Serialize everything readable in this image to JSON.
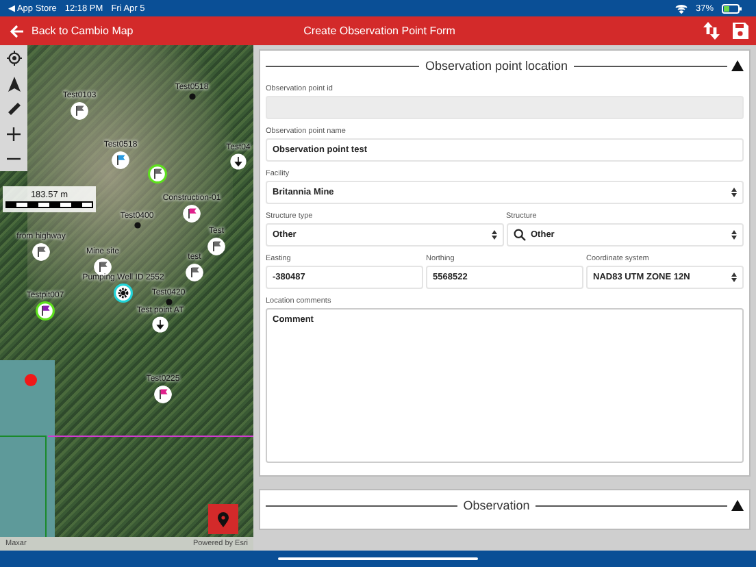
{
  "status_bar": {
    "back_app": "◀ App Store",
    "time": "12:18 PM",
    "date": "Fri Apr 5",
    "battery": "37%"
  },
  "header": {
    "back_label": "Back to Cambio Map",
    "title": "Create Observation Point Form"
  },
  "map": {
    "scale": "183.57 m",
    "attribution_left": "Maxar",
    "attribution_right": "Powered by Esri",
    "markers": [
      {
        "label": "Test0103",
        "kind": "flag",
        "color": "#6b6b6b",
        "ring": false
      },
      {
        "label": "Test0518",
        "kind": "dot"
      },
      {
        "label": "Test0518",
        "kind": "flag",
        "color": "#2a9be0",
        "ring": false
      },
      {
        "kind": "flag",
        "color": "#6b6b6b",
        "ring": true
      },
      {
        "label": "Test04",
        "kind": "drop"
      },
      {
        "label": "Construction-01",
        "kind": "flag",
        "color": "#e0208c",
        "ring": false
      },
      {
        "label": "Test0400",
        "kind": "dot"
      },
      {
        "label": "from highway",
        "kind": "flag",
        "color": "#6b6b6b",
        "ring": false
      },
      {
        "label": "Mine site",
        "kind": "flag",
        "color": "#6b6b6b",
        "ring": false
      },
      {
        "label": "Test",
        "kind": "flag",
        "color": "#6b6b6b",
        "ring": false
      },
      {
        "label": "test",
        "kind": "flag",
        "color": "#6b6b6b",
        "ring": false
      },
      {
        "label": "Pumping Well ID 2552",
        "kind": "gear"
      },
      {
        "label": "Testpit007",
        "kind": "flag",
        "color": "#8a1fb0",
        "ring": true
      },
      {
        "label": "Test0420",
        "kind": "dot"
      },
      {
        "label": "Test point AT",
        "kind": "drop"
      },
      {
        "label": "Test0225",
        "kind": "flag",
        "color": "#e0208c",
        "ring": false
      }
    ]
  },
  "sections": [
    {
      "title": "Observation point location",
      "expanded": true,
      "rows": [
        [
          {
            "label": "Observation point id",
            "kind": "text",
            "disabled": true
          }
        ],
        [
          {
            "label": "Observation point name",
            "kind": "text",
            "value": "Observation point test",
            "disabled": false
          }
        ],
        [
          {
            "label": "Facility",
            "kind": "select",
            "value": "Britannia Mine",
            "disabled": false
          }
        ],
        [
          {
            "label": "Structure type",
            "kind": "select",
            "value": "Other",
            "disabled": false
          },
          {
            "label": "Structure",
            "kind": "search-select",
            "value": "Other",
            "disabled": false
          }
        ],
        [
          {
            "label": "Easting",
            "kind": "text",
            "value": "-380487",
            "disabled": false
          },
          {
            "label": "Northing",
            "kind": "text",
            "value": "5568522",
            "disabled": false
          },
          {
            "label": "Coordinate system",
            "kind": "select",
            "value": "NAD83 UTM ZONE 12N",
            "disabled": false
          }
        ],
        [
          {
            "label": "Location comments",
            "kind": "textarea",
            "placeholder": "Comment",
            "disabled": false
          }
        ]
      ]
    },
    {
      "title": "Observation",
      "expanded": true
    }
  ]
}
